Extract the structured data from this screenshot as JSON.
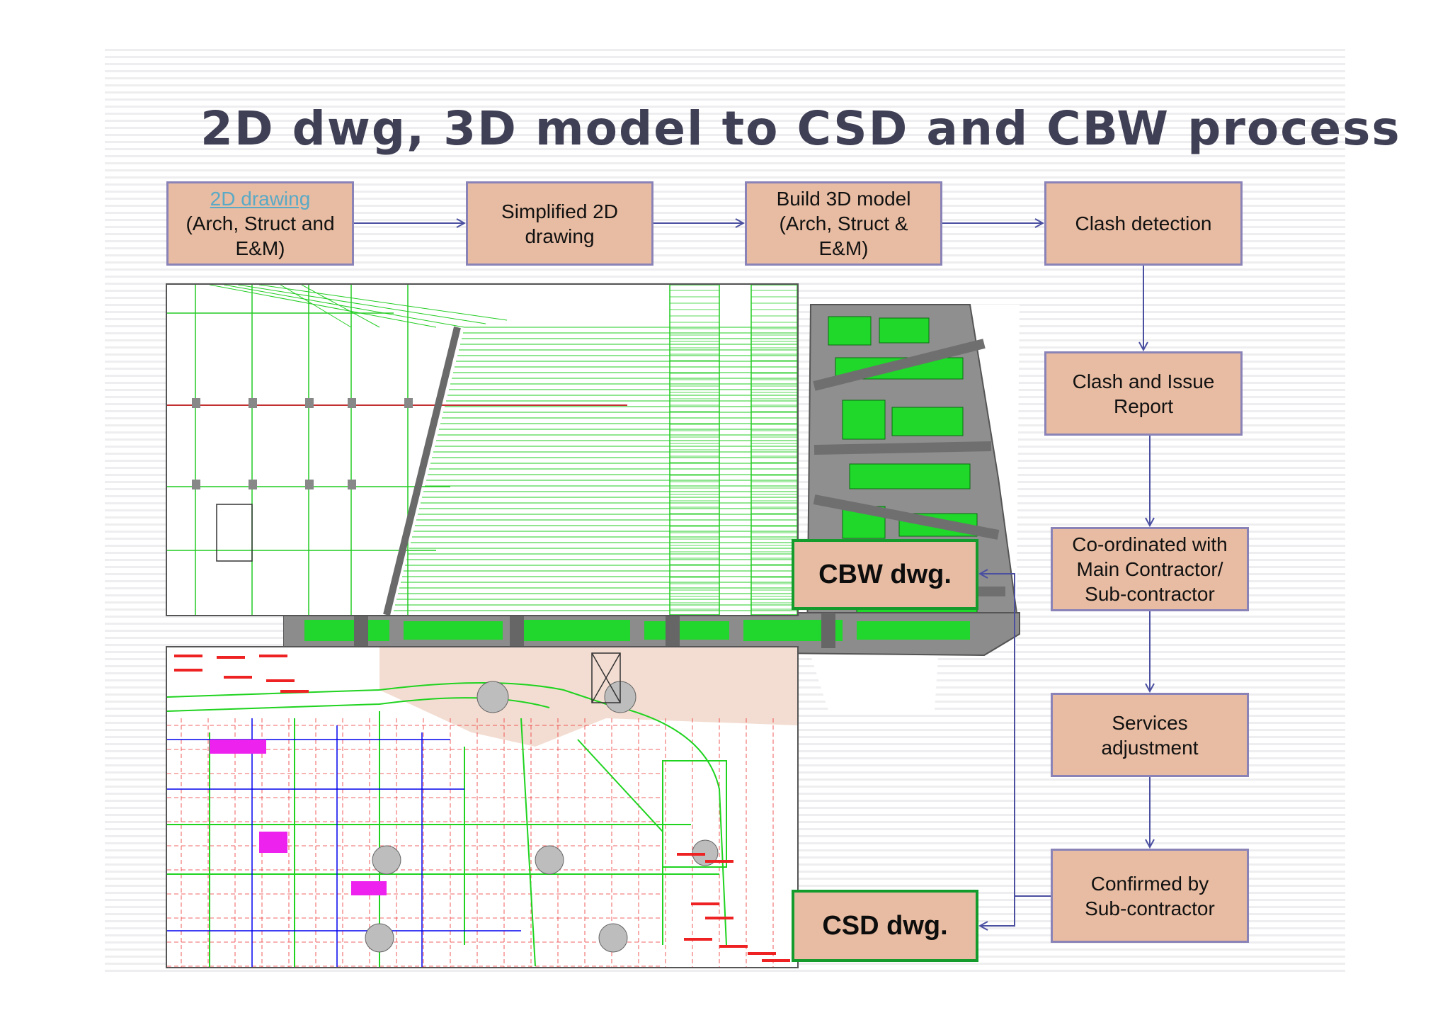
{
  "slide": {
    "title": "2D dwg, 3D model to CSD and CBW process"
  },
  "flow": {
    "step1": {
      "link": "2D drawing",
      "line2": "(Arch, Struct and",
      "line3": "E&M)"
    },
    "step2": {
      "line1": "Simplified 2D",
      "line2": "drawing"
    },
    "step3": {
      "line1": "Build 3D model",
      "line2": "(Arch, Struct &",
      "line3": "E&M)"
    },
    "step4": {
      "line1": "Clash detection"
    },
    "step5": {
      "line1": "Clash and Issue",
      "line2": "Report"
    },
    "step6": {
      "line1": "Co-ordinated with",
      "line2": "Main Contractor/",
      "line3": "Sub-contractor"
    },
    "step7": {
      "line1": "Services",
      "line2": "adjustment"
    },
    "step8": {
      "line1": "Confirmed by",
      "line2": "Sub-contractor"
    }
  },
  "outputs": {
    "cbw_label": "CBW dwg.",
    "csd_label": "CSD dwg."
  },
  "colors": {
    "box_fill": "#e8bca2",
    "box_border": "#8a83b8",
    "arrow": "#4a4fa0",
    "output_border": "#139b2c",
    "title": "#3f3f55"
  }
}
